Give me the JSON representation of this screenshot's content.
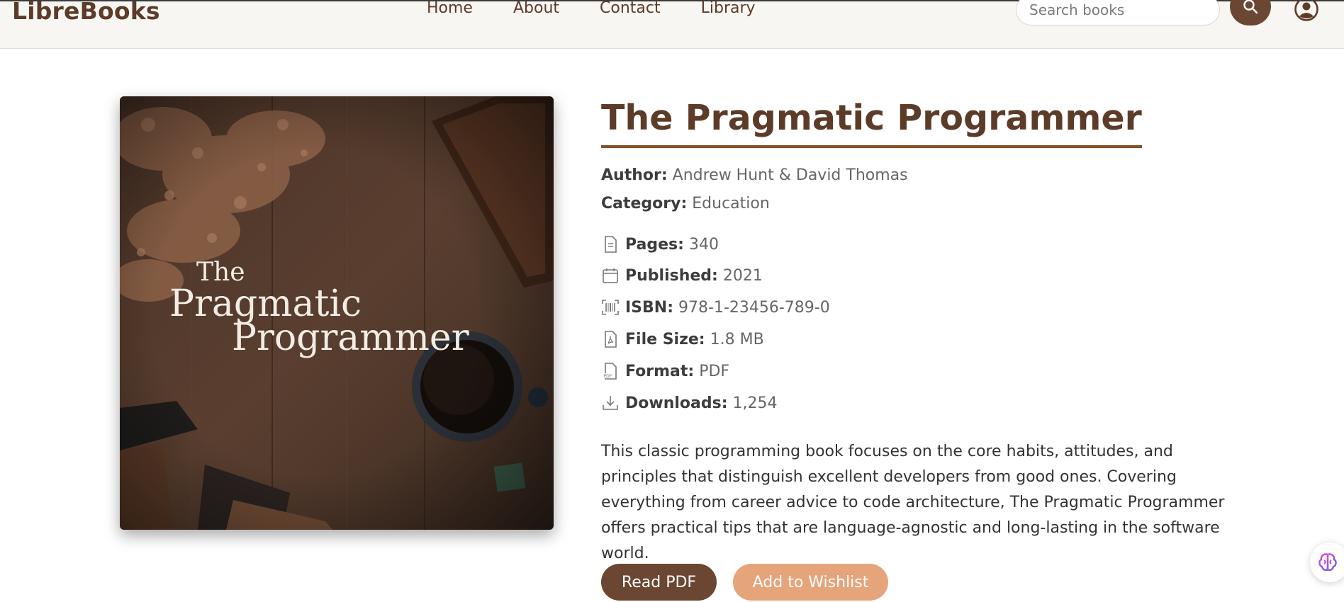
{
  "header": {
    "logo": "LibreBooks",
    "nav": [
      "Home",
      "About",
      "Contact",
      "Library"
    ],
    "search_placeholder": "Search books"
  },
  "cover": {
    "line1": "The",
    "line2": "Pragmatic",
    "line3": "Programmer"
  },
  "book": {
    "title": "The Pragmatic Programmer",
    "author_label": "Author:",
    "author": "Andrew Hunt & David Thomas",
    "category_label": "Category:",
    "category": "Education",
    "specs": [
      {
        "icon": "document-icon",
        "label": "Pages:",
        "value": "340"
      },
      {
        "icon": "calendar-icon",
        "label": "Published:",
        "value": "2021"
      },
      {
        "icon": "barcode-icon",
        "label": "ISBN:",
        "value": "978-1-23456-789-0"
      },
      {
        "icon": "pdf-file-icon",
        "label": "File Size:",
        "value": "1.8 MB"
      },
      {
        "icon": "pdf-format-icon",
        "label": "Format:",
        "value": "PDF"
      },
      {
        "icon": "download-icon",
        "label": "Downloads:",
        "value": "1,254"
      }
    ],
    "description": "This classic programming book focuses on the core habits, attitudes, and principles that distinguish excellent developers from good ones. Covering everything from career advice to code architecture, The Pragmatic Programmer offers practical tips that are language-agnostic and long-lasting in the software world."
  },
  "actions": {
    "read": "Read PDF",
    "wishlist": "Add to Wishlist"
  },
  "colors": {
    "brand_brown": "#5c3b29",
    "button_brown": "#6b4632",
    "wishlist_peach": "#e5a47a"
  }
}
